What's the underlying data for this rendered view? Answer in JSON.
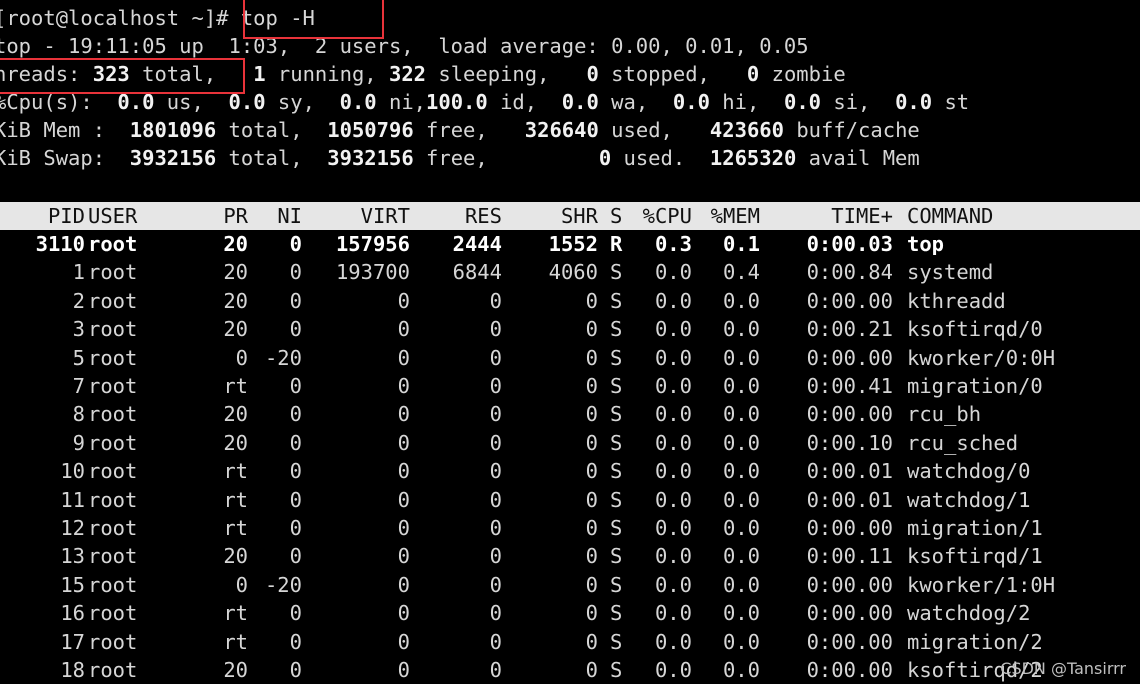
{
  "prompt": "[root@localhost ~]#",
  "command": "top -H",
  "summary": {
    "top_line": "top - 19:11:05 up  1:03,  2 users,  load average: 0.00, 0.01, 0.05",
    "threads_label": "hreads: ",
    "threads_total": "323",
    "threads_total_word": " total,",
    "threads_running": "1",
    "threads_running_word": " running, ",
    "threads_sleeping": "322",
    "threads_sleeping_word": " sleeping,   ",
    "threads_stopped": "0",
    "threads_stopped_word": " stopped,   ",
    "threads_zombie": "0",
    "threads_zombie_word": " zombie",
    "cpu_label": "%Cpu(s):  ",
    "cpu_us": "0.0",
    "cpu_us_word": " us,  ",
    "cpu_sy": "0.0",
    "cpu_sy_word": " sy,  ",
    "cpu_ni": "0.0",
    "cpu_ni_word": " ni,",
    "cpu_id": "100.0",
    "cpu_id_word": " id,  ",
    "cpu_wa": "0.0",
    "cpu_wa_word": " wa,  ",
    "cpu_hi": "0.0",
    "cpu_hi_word": " hi,  ",
    "cpu_si": "0.0",
    "cpu_si_word": " si,  ",
    "cpu_st": "0.0",
    "cpu_st_word": " st",
    "mem_label": "KiB Mem :  ",
    "mem_total": "1801096",
    "mem_total_word": " total,  ",
    "mem_free": "1050796",
    "mem_free_word": " free,   ",
    "mem_used": "326640",
    "mem_used_word": " used,   ",
    "mem_buff": "423660",
    "mem_buff_word": " buff/cache",
    "swap_label": "KiB Swap:  ",
    "swap_total": "3932156",
    "swap_total_word": " total,  ",
    "swap_free": "3932156",
    "swap_free_word": " free,         ",
    "swap_used": "0",
    "swap_used_word": " used.  ",
    "swap_avail": "1265320",
    "swap_avail_word": " avail Mem"
  },
  "columns": [
    "PID",
    "USER",
    "PR",
    "NI",
    "VIRT",
    "RES",
    "SHR",
    "S",
    "%CPU",
    "%MEM",
    "TIME+",
    "COMMAND"
  ],
  "rows": [
    [
      "3110",
      "root",
      "20",
      "0",
      "157956",
      "2444",
      "1552",
      "R",
      "0.3",
      "0.1",
      "0:00.03",
      "top"
    ],
    [
      "1",
      "root",
      "20",
      "0",
      "193700",
      "6844",
      "4060",
      "S",
      "0.0",
      "0.4",
      "0:00.84",
      "systemd"
    ],
    [
      "2",
      "root",
      "20",
      "0",
      "0",
      "0",
      "0",
      "S",
      "0.0",
      "0.0",
      "0:00.00",
      "kthreadd"
    ],
    [
      "3",
      "root",
      "20",
      "0",
      "0",
      "0",
      "0",
      "S",
      "0.0",
      "0.0",
      "0:00.21",
      "ksoftirqd/0"
    ],
    [
      "5",
      "root",
      "0",
      "-20",
      "0",
      "0",
      "0",
      "S",
      "0.0",
      "0.0",
      "0:00.00",
      "kworker/0:0H"
    ],
    [
      "7",
      "root",
      "rt",
      "0",
      "0",
      "0",
      "0",
      "S",
      "0.0",
      "0.0",
      "0:00.41",
      "migration/0"
    ],
    [
      "8",
      "root",
      "20",
      "0",
      "0",
      "0",
      "0",
      "S",
      "0.0",
      "0.0",
      "0:00.00",
      "rcu_bh"
    ],
    [
      "9",
      "root",
      "20",
      "0",
      "0",
      "0",
      "0",
      "S",
      "0.0",
      "0.0",
      "0:00.10",
      "rcu_sched"
    ],
    [
      "10",
      "root",
      "rt",
      "0",
      "0",
      "0",
      "0",
      "S",
      "0.0",
      "0.0",
      "0:00.01",
      "watchdog/0"
    ],
    [
      "11",
      "root",
      "rt",
      "0",
      "0",
      "0",
      "0",
      "S",
      "0.0",
      "0.0",
      "0:00.01",
      "watchdog/1"
    ],
    [
      "12",
      "root",
      "rt",
      "0",
      "0",
      "0",
      "0",
      "S",
      "0.0",
      "0.0",
      "0:00.00",
      "migration/1"
    ],
    [
      "13",
      "root",
      "20",
      "0",
      "0",
      "0",
      "0",
      "S",
      "0.0",
      "0.0",
      "0:00.11",
      "ksoftirqd/1"
    ],
    [
      "15",
      "root",
      "0",
      "-20",
      "0",
      "0",
      "0",
      "S",
      "0.0",
      "0.0",
      "0:00.00",
      "kworker/1:0H"
    ],
    [
      "16",
      "root",
      "rt",
      "0",
      "0",
      "0",
      "0",
      "S",
      "0.0",
      "0.0",
      "0:00.00",
      "watchdog/2"
    ],
    [
      "17",
      "root",
      "rt",
      "0",
      "0",
      "0",
      "0",
      "S",
      "0.0",
      "0.0",
      "0:00.00",
      "migration/2"
    ],
    [
      "18",
      "root",
      "20",
      "0",
      "0",
      "0",
      "0",
      "S",
      "0.0",
      "0.0",
      "0:00.00",
      "ksoftirqd/2"
    ]
  ],
  "highlight_color": "#e8333a",
  "watermark": "CSDN @Tansirrr"
}
